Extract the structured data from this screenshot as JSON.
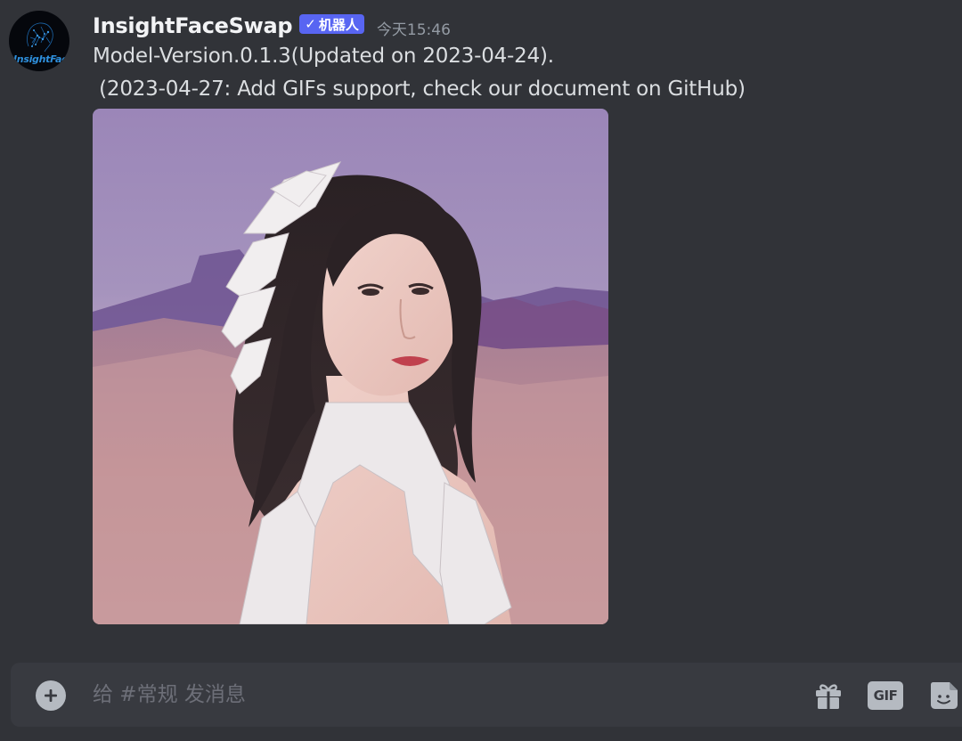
{
  "message": {
    "avatar_text": "InsightFace",
    "username": "InsightFaceSwap",
    "badge": {
      "check": "✓",
      "label": "机器人"
    },
    "timestamp": "今天15:46",
    "lines": [
      "Model-Version.0.1.3(Updated on 2023-04-24).",
      " (2023-04-27: Add GIFs support, check our document on GitHub)"
    ]
  },
  "composer": {
    "add_icon": "plus-circle-icon",
    "placeholder": "给 #常规 发消息",
    "tools": {
      "gift_icon": "gift-icon",
      "gif_label": "GIF",
      "sticker_icon": "sticker-icon"
    }
  },
  "colors": {
    "background": "#313338",
    "composer": "#383a40",
    "badge": "#5865f2",
    "username": "#f2f3f5",
    "text": "#dbdee1",
    "muted": "#949ba4"
  }
}
